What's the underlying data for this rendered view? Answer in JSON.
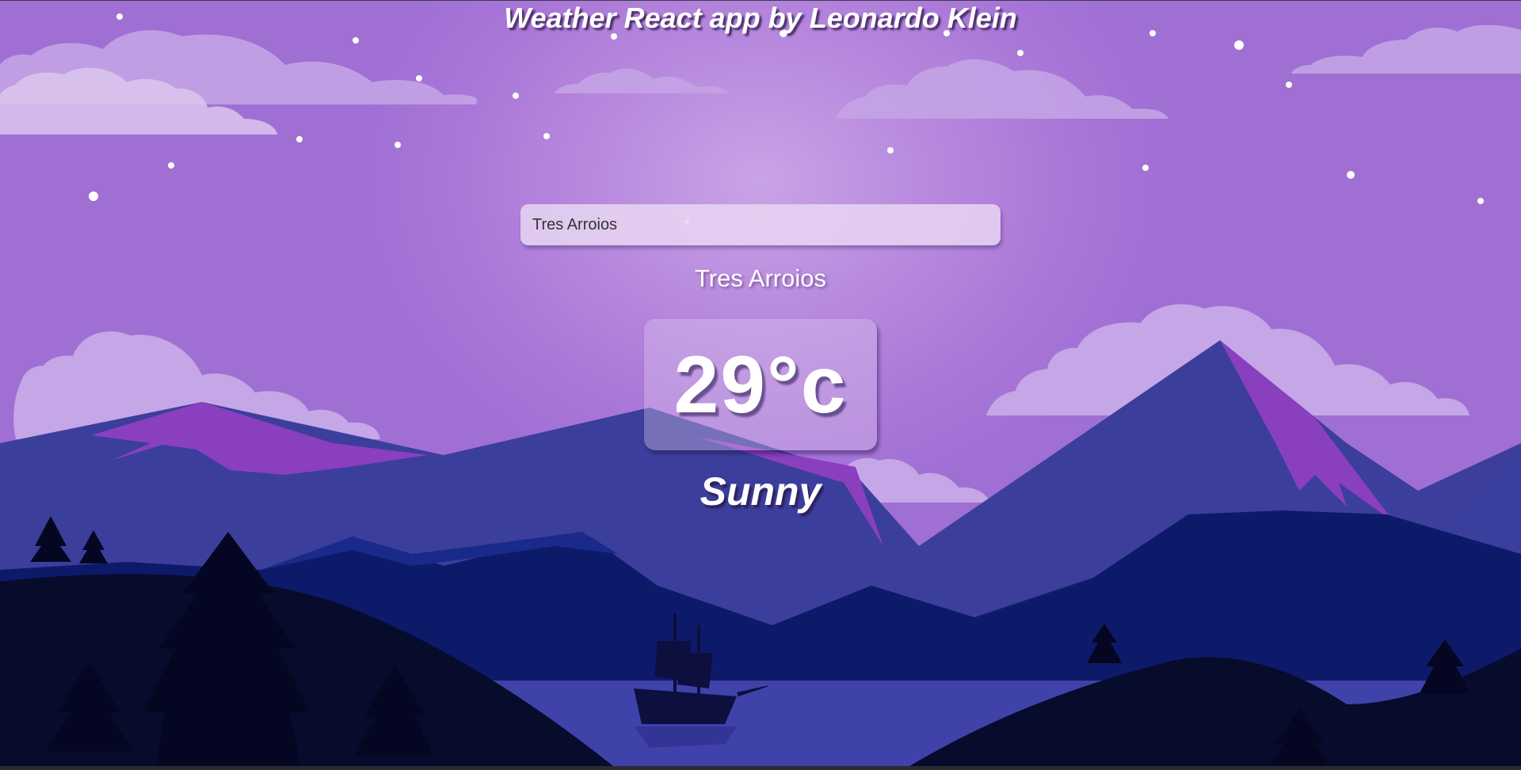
{
  "app": {
    "title": "Weather React app by Leonardo Klein"
  },
  "search": {
    "value": "Tres Arroios"
  },
  "weather": {
    "location": "Tres Arroios",
    "temperature": "29°c",
    "condition": "Sunny"
  },
  "scene": {
    "description_icon": "mountain-landscape-illustration",
    "colors": {
      "sky": "#a977d8",
      "mountain_far": "#3c3e9c",
      "mountain_mid": "#0d1a6a",
      "mountain_near": "#070b2c",
      "accent_peak": "#8a3fbf",
      "lake": "#3f42a8"
    }
  }
}
